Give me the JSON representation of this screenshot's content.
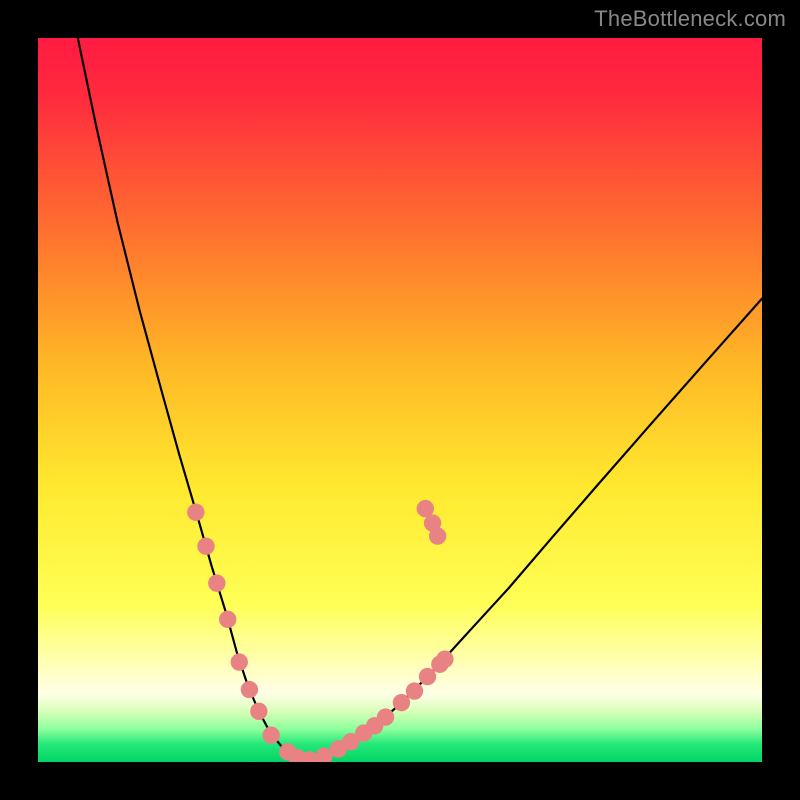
{
  "watermark": "TheBottleneck.com",
  "chart_data": {
    "type": "line",
    "title": "",
    "xlabel": "",
    "ylabel": "",
    "xlim": [
      0,
      1000
    ],
    "ylim": [
      0,
      1000
    ],
    "gradient_stops": [
      {
        "offset": 0.0,
        "color": "#ff1b41"
      },
      {
        "offset": 0.08,
        "color": "#ff2a3e"
      },
      {
        "offset": 0.25,
        "color": "#ff6a30"
      },
      {
        "offset": 0.45,
        "color": "#ffb726"
      },
      {
        "offset": 0.62,
        "color": "#ffe92f"
      },
      {
        "offset": 0.78,
        "color": "#ffff55"
      },
      {
        "offset": 0.86,
        "color": "#ffffb0"
      },
      {
        "offset": 0.905,
        "color": "#ffffe8"
      },
      {
        "offset": 0.93,
        "color": "#d8ffb8"
      },
      {
        "offset": 0.955,
        "color": "#8cff9c"
      },
      {
        "offset": 0.975,
        "color": "#26e87a"
      },
      {
        "offset": 1.0,
        "color": "#00d465"
      }
    ],
    "green_band": {
      "y0": 930,
      "y1": 1000
    },
    "series": [
      {
        "name": "bottleneck-curve",
        "color": "#000000",
        "stroke_width": 3,
        "x": [
          55,
          80,
          110,
          140,
          170,
          195,
          220,
          240,
          260,
          275,
          290,
          305,
          320,
          335,
          350,
          370,
          395,
          425,
          460,
          500,
          545,
          595,
          650,
          710,
          775,
          845,
          920,
          1000
        ],
        "y": [
          0,
          120,
          255,
          375,
          485,
          575,
          660,
          730,
          795,
          850,
          895,
          930,
          958,
          977,
          990,
          997,
          992,
          978,
          955,
          920,
          875,
          820,
          760,
          690,
          615,
          535,
          450,
          360
        ]
      }
    ],
    "markers": {
      "name": "highlighted-points",
      "color": "#e98383",
      "radius": 12,
      "points": [
        {
          "x": 218,
          "y": 655
        },
        {
          "x": 232,
          "y": 702
        },
        {
          "x": 247,
          "y": 753
        },
        {
          "x": 262,
          "y": 803
        },
        {
          "x": 278,
          "y": 862
        },
        {
          "x": 292,
          "y": 900
        },
        {
          "x": 305,
          "y": 930
        },
        {
          "x": 322,
          "y": 963
        },
        {
          "x": 345,
          "y": 986
        },
        {
          "x": 358,
          "y": 994
        },
        {
          "x": 375,
          "y": 997
        },
        {
          "x": 395,
          "y": 992
        },
        {
          "x": 415,
          "y": 982
        },
        {
          "x": 432,
          "y": 972
        },
        {
          "x": 450,
          "y": 960
        },
        {
          "x": 465,
          "y": 950
        },
        {
          "x": 480,
          "y": 938
        },
        {
          "x": 502,
          "y": 918
        },
        {
          "x": 520,
          "y": 902
        },
        {
          "x": 538,
          "y": 882
        },
        {
          "x": 555,
          "y": 865
        },
        {
          "x": 562,
          "y": 858
        },
        {
          "x": 535,
          "y": 650
        },
        {
          "x": 545,
          "y": 670
        },
        {
          "x": 552,
          "y": 688
        }
      ]
    }
  }
}
